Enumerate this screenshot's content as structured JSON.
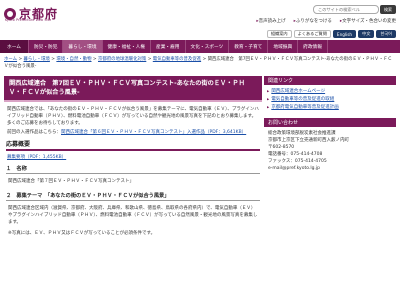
{
  "header": {
    "logo_text": "京都府",
    "logo_sub": "Kyoto Prefecture Web Site",
    "search_placeholder": "このサイトの検索ベル",
    "search_button": "検索",
    "top_links": [
      "音声読み上げ",
      "ふりがなをつける",
      "文字サイズ・色合いの変更",
      "組織案内"
    ],
    "sub_links": [
      "組織案内",
      "よくあるご質問",
      "サイトマップ"
    ]
  },
  "lang": {
    "current": "日本語",
    "items": [
      "English",
      "中文",
      "한국어"
    ]
  },
  "nav": {
    "items": [
      "ホーム",
      "防災・防犯",
      "暮らし・環境",
      "健康・福祉・人権",
      "産業・雇用",
      "文化・スポーツ",
      "教育・子育て",
      "地域振興",
      "府政情報"
    ]
  },
  "breadcrumb": {
    "items": [
      "ホーム",
      "暮らし・環境",
      "環境・自然・動物",
      "京都府の地球温暖化対策",
      "電気自動車等の普及促進",
      "関西広域連合　第7回ＥＶ・ＰＨＶ・ＦＣＶ写真コンテスト-あなたの街のＥＶ・ＰＨＶ・ＦＣＶが似合う風景-"
    ]
  },
  "main": {
    "title": "関西広域連合　第7回ＥＶ・ＰＨＶ・ＦＣＶ写真コンテスト-あなたの街のＥＶ・ＰＨＶ・ＦＣＶが似合う風景-",
    "intro": "関西広域連合では、「あなたの街のＥＶ・ＰＨＶ・ＦＣＶが似合う風景」を募集テーマに、電気自動車（ＥＶ）、プラグインハイブリッド自動車（ＰＨＶ）、燃料電池自動車（ＦＣＶ）が写っている自然や観光地の風景写真を下記のとおり募集します。多くのご応募をお待ちしております。",
    "prev_result_prefix": "前回の入選作品はこちら：",
    "prev_result_link": "関西広域連合「第６回ＥＶ・ＰＨＶ・ＦＣＶ写真コンテスト」入選作品（PDF：3,641KB）",
    "section_title": "応募概要",
    "pdf_link": "募集要項（PDF：1,455KB）",
    "s1_title": "１　名称",
    "s1_body": "関西広域連合「第７回ＥＶ・ＰＨＶ・ＦＣＶ写真コンテスト」",
    "s2_title": "２　募集テーマ　「あなたの街のＥＶ・ＰＨＶ・ＦＣＶが似合う風景」",
    "s2_body": "関西広域連合区域内（滋賀県、京都府、大阪府、兵庫県、和歌山県、徳島県、鳥取県の各府県内）で、電気自動車（ＥＶ）やプラグインハイブリッド自動車（ＰＨＶ）、燃料電池自動車（ＦＣＶ）が写っている自然風景・観光地の風景写真を募集します。",
    "s2_note": "※写真には、ＥＶ、ＰＨＶ又はＦＣＶが写っていることが必須条件です。"
  },
  "side": {
    "related_head": "関連リンク",
    "related": [
      "関西広域連合ホームページ",
      "電気自動車等の普及促進の取組",
      "京都府電気自動車等普及促進計画"
    ],
    "contact_head": "お問い合わせ",
    "contact_lines": [
      "総合政策環境部脱炭素社会推進課",
      "京都市上京区下立売通新町西入薮ノ内町",
      "〒602-8570",
      "電話番号：075-414-4708",
      "ファックス：075-414-4705",
      "e-mail@pref.kyoto.lg.jp"
    ]
  }
}
